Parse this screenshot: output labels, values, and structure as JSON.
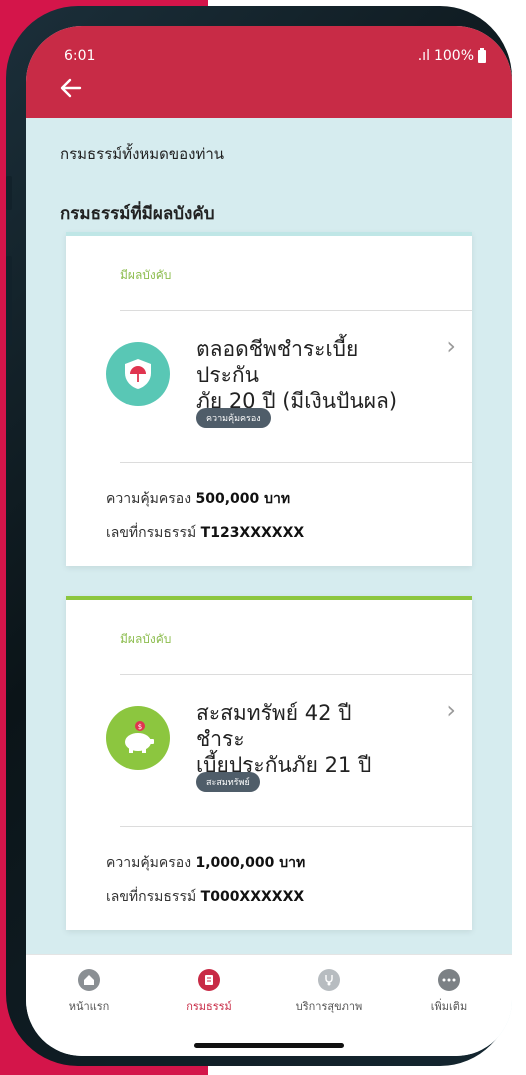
{
  "status_bar": {
    "time": "6:01",
    "signal": ".ıl",
    "battery_text": "100%"
  },
  "header": {
    "back_icon": "arrow-left-icon"
  },
  "page": {
    "all_policies_title": "กรมธรรม์ทั้งหมดของท่าน",
    "active_policies_title": "กรมธรรม์ที่มีผลบังคับ"
  },
  "policies": [
    {
      "status": "มีผลบังคับ",
      "name_line1": "ตลอดชีพชำระเบี้ยประกัน",
      "name_line2": "ภัย 20 ปี (มีเงินปันผล)",
      "badge": "ความคุ้มครอง",
      "coverage_label": "ความคุ้มครอง",
      "coverage_value": "500,000 บาท",
      "number_label": "เลขที่กรมธรรม์",
      "number_value": "T123XXXXXX",
      "icon": "umbrella-shield-icon",
      "icon_color": "#59c7b5",
      "accent_color": "#bfe6e6"
    },
    {
      "status": "มีผลบังคับ",
      "name_line1": "สะสมทรัพย์ 42 ปี ชำระ",
      "name_line2": "เบี้ยประกันภัย 21 ปี",
      "badge": "สะสมทรัพย์",
      "coverage_label": "ความคุ้มครอง",
      "coverage_value": "1,000,000 บาท",
      "number_label": "เลขที่กรมธรรม์",
      "number_value": "T000XXXXXX",
      "icon": "piggy-bank-icon",
      "icon_color": "#8cc63f",
      "accent_color": "#8cc63f"
    }
  ],
  "bottom_nav": {
    "items": [
      {
        "label": "หน้าแรก",
        "icon": "home-icon"
      },
      {
        "label": "กรมธรรม์",
        "icon": "policy-document-icon",
        "active": true
      },
      {
        "label": "บริการสุขภาพ",
        "icon": "stethoscope-icon"
      },
      {
        "label": "เพิ่มเติม",
        "icon": "more-dots-icon"
      }
    ]
  },
  "colors": {
    "brand_red": "#c82b46",
    "background": "#d6ecef",
    "status_green": "#8dbd4f",
    "badge_gray": "#4f5d69"
  }
}
